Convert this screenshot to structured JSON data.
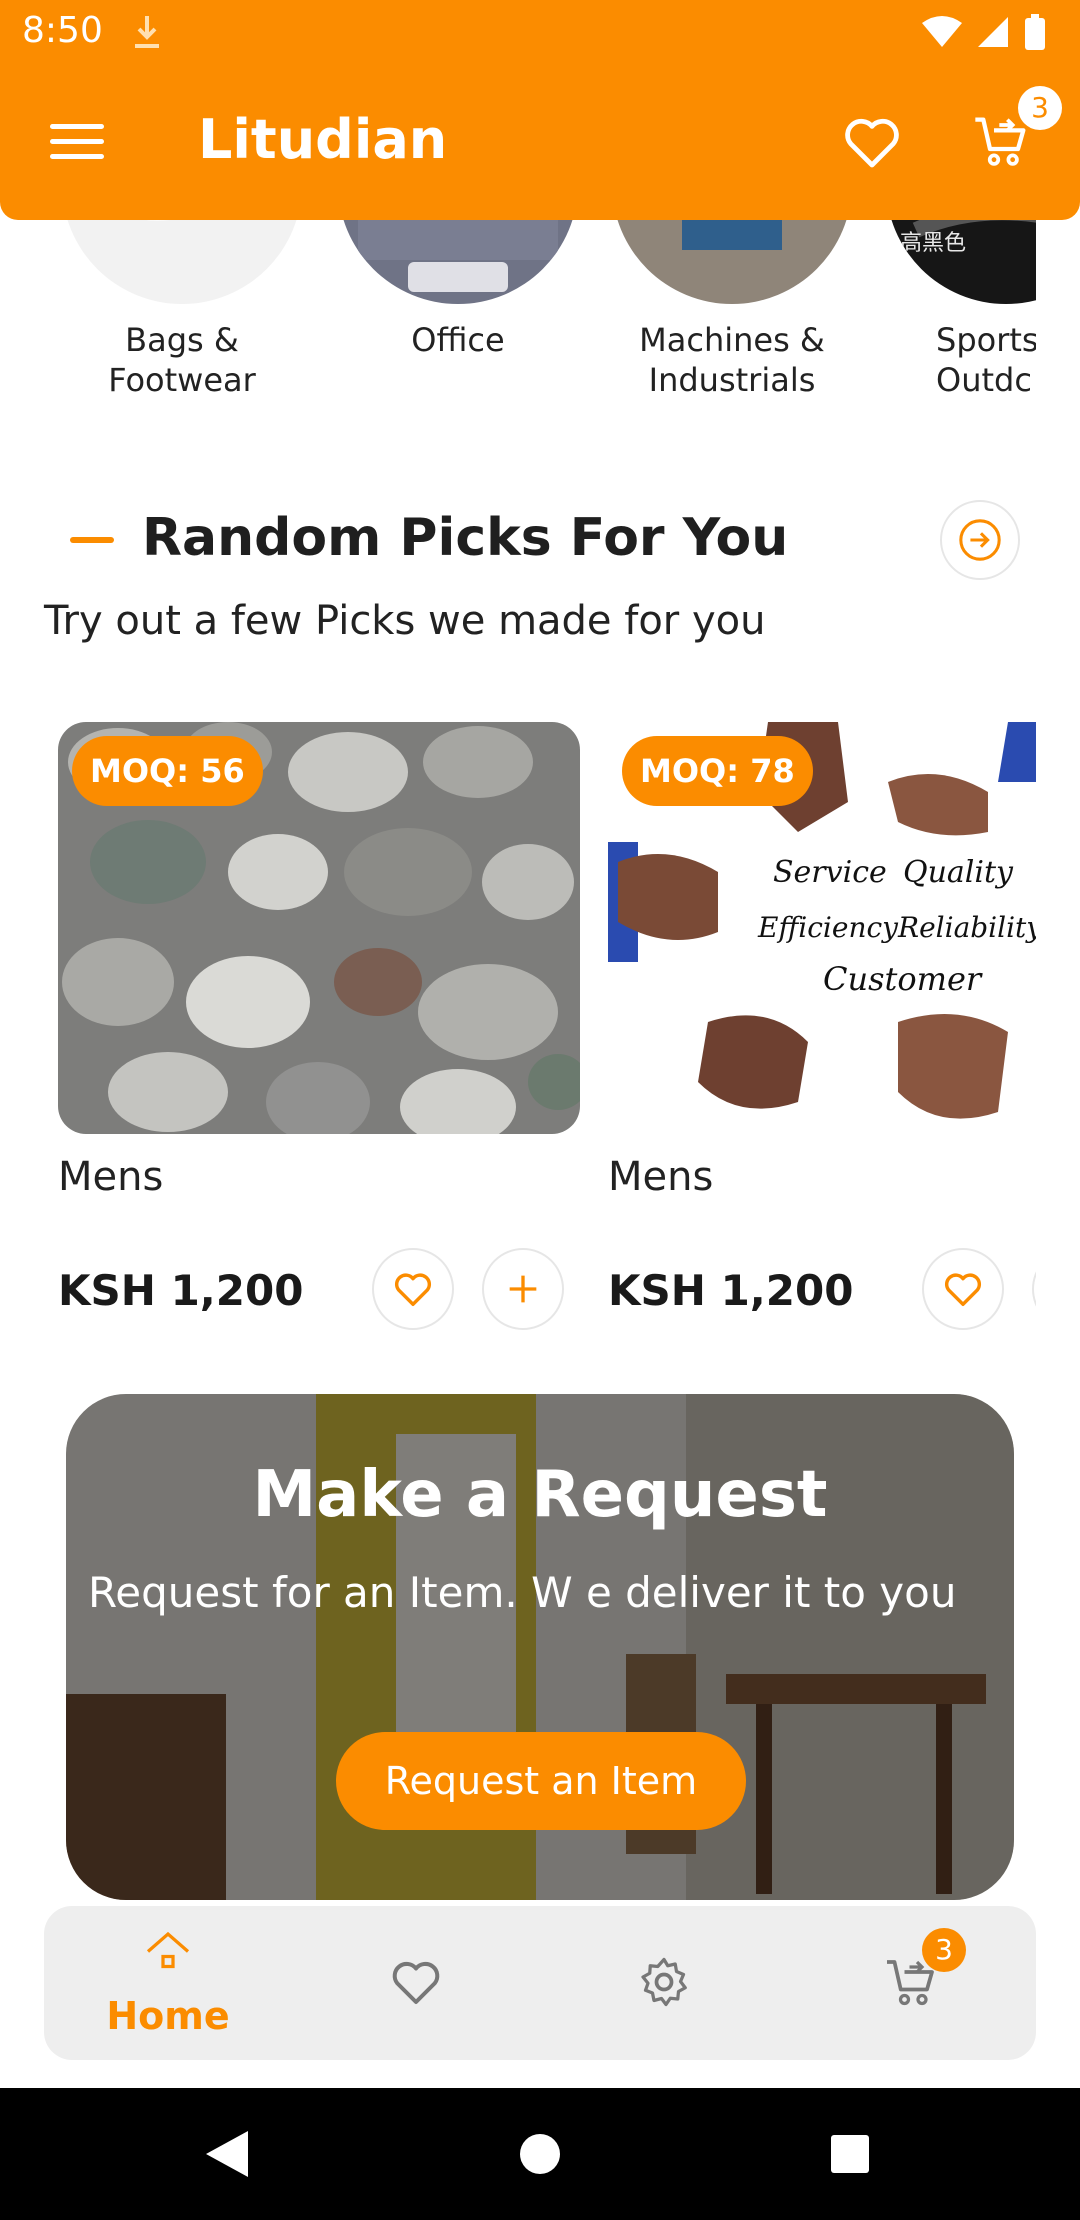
{
  "status_bar": {
    "time": "8:50"
  },
  "app": {
    "title": "Litudian",
    "cart_count": "3"
  },
  "categories": [
    {
      "name": "Bags &\nFootwear"
    },
    {
      "name": "Office"
    },
    {
      "name": "Machines &\nIndustrials"
    },
    {
      "name": "Sports\nOutdc"
    }
  ],
  "section": {
    "title": "Random Picks For You",
    "subtitle": "Try out a few Picks we made for you"
  },
  "products": [
    {
      "moq": "MOQ: 56",
      "name": "Mens",
      "price": "KSH 1,200"
    },
    {
      "moq": "MOQ: 78",
      "name": "Mens",
      "price": "KSH 1,200",
      "image_words": [
        "Service",
        "Quality",
        "Efficiency",
        "Reliability",
        "Customer"
      ]
    }
  ],
  "request_banner": {
    "title": "Make a Request",
    "subtitle": "Request for an Item. W e deliver it to you",
    "button_label": "Request an Item"
  },
  "bottom_nav": {
    "home_label": "Home",
    "cart_count": "3",
    "items": [
      "home-icon",
      "heart-icon",
      "gear-icon",
      "cart-icon"
    ]
  },
  "colors": {
    "accent": "#FB8C00",
    "nav_bg": "#EEEEEE"
  }
}
